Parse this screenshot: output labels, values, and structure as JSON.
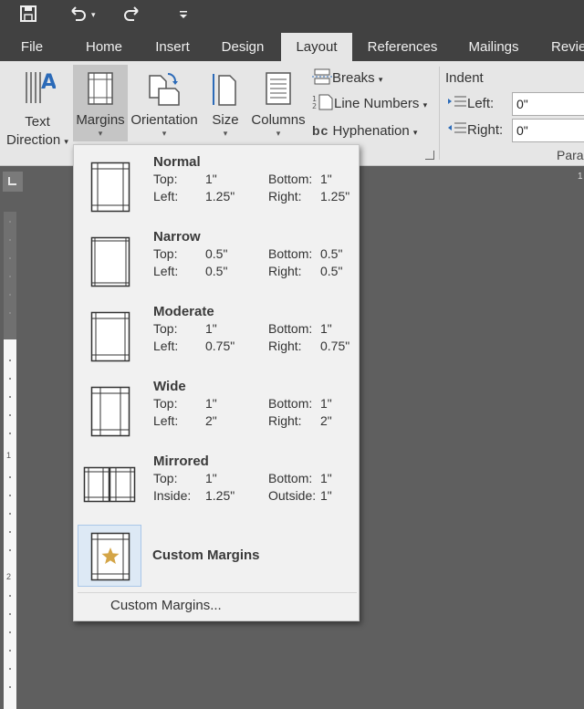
{
  "quick_access": {
    "save_icon": "save-icon",
    "undo_icon": "undo-icon",
    "redo_icon": "redo-icon",
    "customize_icon": "customize-icon"
  },
  "tabs": [
    {
      "label": "File"
    },
    {
      "label": "Home"
    },
    {
      "label": "Insert"
    },
    {
      "label": "Design"
    },
    {
      "label": "Layout",
      "active": true
    },
    {
      "label": "References"
    },
    {
      "label": "Mailings"
    },
    {
      "label": "Revie"
    }
  ],
  "ribbon": {
    "text_direction": {
      "line1": "Text",
      "line2": "Direction",
      "arrow": "▾"
    },
    "margins": {
      "label": "Margins",
      "arrow": "▾"
    },
    "orientation": {
      "label": "Orientation",
      "arrow": "▾"
    },
    "size": {
      "label": "Size",
      "arrow": "▾"
    },
    "columns": {
      "label": "Columns",
      "arrow": "▾"
    },
    "breaks": {
      "label": "Breaks",
      "arrow": "▾"
    },
    "line_numbers": {
      "label": "Line Numbers",
      "arrow": "▾"
    },
    "hyphenation": {
      "label": "Hyphenation",
      "arrow": "▾",
      "icon_text": "bc"
    },
    "indent": {
      "title": "Indent",
      "left_label": "Left:",
      "left_value": "0\"",
      "right_label": "Right:",
      "right_value": "0\""
    },
    "paragraph_group_label": "Parag"
  },
  "ruler": {
    "marks": [
      "1",
      "2"
    ],
    "top_right": "1"
  },
  "margins_menu": {
    "options": [
      {
        "name": "Normal",
        "label1": "Top:",
        "value1": "1\"",
        "label2": "Bottom:",
        "value2": "1\"",
        "label3": "Left:",
        "value3": "1.25\"",
        "label4": "Right:",
        "value4": "1.25\""
      },
      {
        "name": "Narrow",
        "label1": "Top:",
        "value1": "0.5\"",
        "label2": "Bottom:",
        "value2": "0.5\"",
        "label3": "Left:",
        "value3": "0.5\"",
        "label4": "Right:",
        "value4": "0.5\""
      },
      {
        "name": "Moderate",
        "label1": "Top:",
        "value1": "1\"",
        "label2": "Bottom:",
        "value2": "1\"",
        "label3": "Left:",
        "value3": "0.75\"",
        "label4": "Right:",
        "value4": "0.75\""
      },
      {
        "name": "Wide",
        "label1": "Top:",
        "value1": "1\"",
        "label2": "Bottom:",
        "value2": "1\"",
        "label3": "Left:",
        "value3": "2\"",
        "label4": "Right:",
        "value4": "2\""
      },
      {
        "name": "Mirrored",
        "label1": "Top:",
        "value1": "1\"",
        "label2": "Bottom:",
        "value2": "1\"",
        "label3": "Inside:",
        "value3": "1.25\"",
        "label4": "Outside:",
        "value4": "1\""
      }
    ],
    "custom_title": "Custom Margins",
    "custom_link": "Custom Margins..."
  }
}
